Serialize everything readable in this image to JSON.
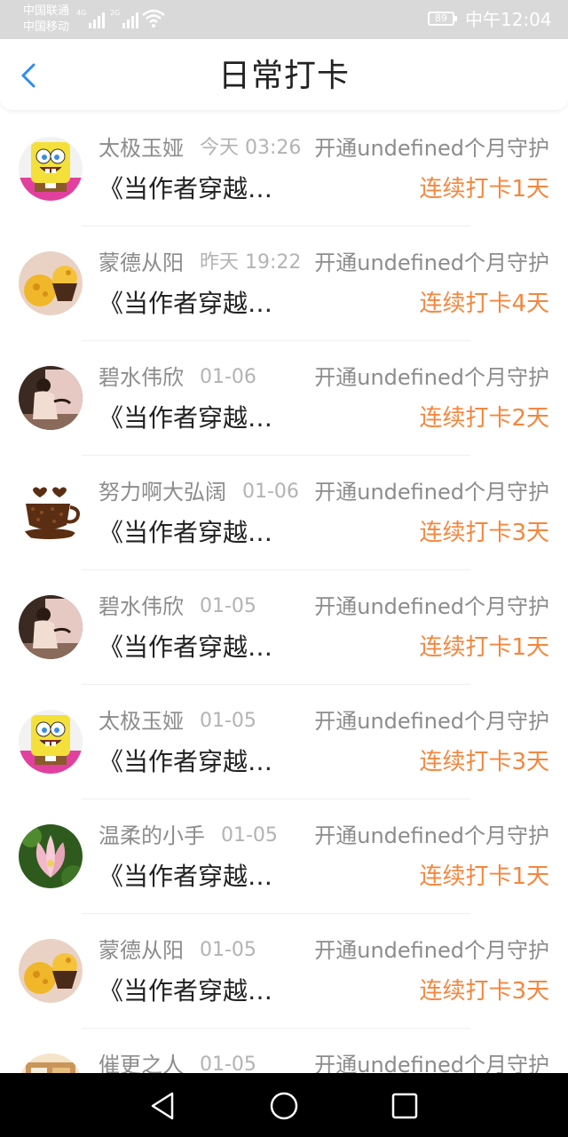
{
  "status_bar": {
    "carrier_1": "中国联通",
    "carrier_2": "中国移动",
    "network_1": "4G",
    "network_2": "2G",
    "battery": "89",
    "time": "中午12:04"
  },
  "header": {
    "back_icon": "chevron-left-icon",
    "title": "日常打卡"
  },
  "colors": {
    "accent_orange": "#f3873e",
    "back_blue": "#2d8df0",
    "text_gray": "#8c8c8c",
    "text_dark": "#222222"
  },
  "items": [
    {
      "name": "太极玉娅",
      "time": "今天 03:26",
      "guard": "开通undefined个月守护",
      "book": "《当作者穿越…",
      "streak": "连续打卡1天",
      "avatar": "spongebob"
    },
    {
      "name": "蒙德从阳",
      "time": "昨天 19:22",
      "guard": "开通undefined个月守护",
      "book": "《当作者穿越…",
      "streak": "连续打卡4天",
      "avatar": "cupcake"
    },
    {
      "name": "碧水伟欣",
      "time": "01-06",
      "guard": "开通undefined个月守护",
      "book": "《当作者穿越…",
      "streak": "连续打卡2天",
      "avatar": "photo-person"
    },
    {
      "name": "努力啊大弘阔",
      "time": "01-06",
      "guard": "开通undefined个月守护",
      "book": "《当作者穿越…",
      "streak": "连续打卡3天",
      "avatar": "coffee-cup"
    },
    {
      "name": "碧水伟欣",
      "time": "01-05",
      "guard": "开通undefined个月守护",
      "book": "《当作者穿越…",
      "streak": "连续打卡1天",
      "avatar": "photo-person"
    },
    {
      "name": "太极玉娅",
      "time": "01-05",
      "guard": "开通undefined个月守护",
      "book": "《当作者穿越…",
      "streak": "连续打卡3天",
      "avatar": "spongebob"
    },
    {
      "name": "温柔的小手",
      "time": "01-05",
      "guard": "开通undefined个月守护",
      "book": "《当作者穿越…",
      "streak": "连续打卡1天",
      "avatar": "lotus"
    },
    {
      "name": "蒙德从阳",
      "time": "01-05",
      "guard": "开通undefined个月守护",
      "book": "《当作者穿越…",
      "streak": "连续打卡3天",
      "avatar": "cupcake"
    },
    {
      "name": "催更之人",
      "time": "01-05",
      "guard": "开通undefined个月守护",
      "book": "",
      "streak": "",
      "avatar": "cartoon"
    }
  ],
  "nav_bar": {
    "back": "triangle-back-icon",
    "home": "circle-home-icon",
    "recents": "square-recents-icon"
  }
}
